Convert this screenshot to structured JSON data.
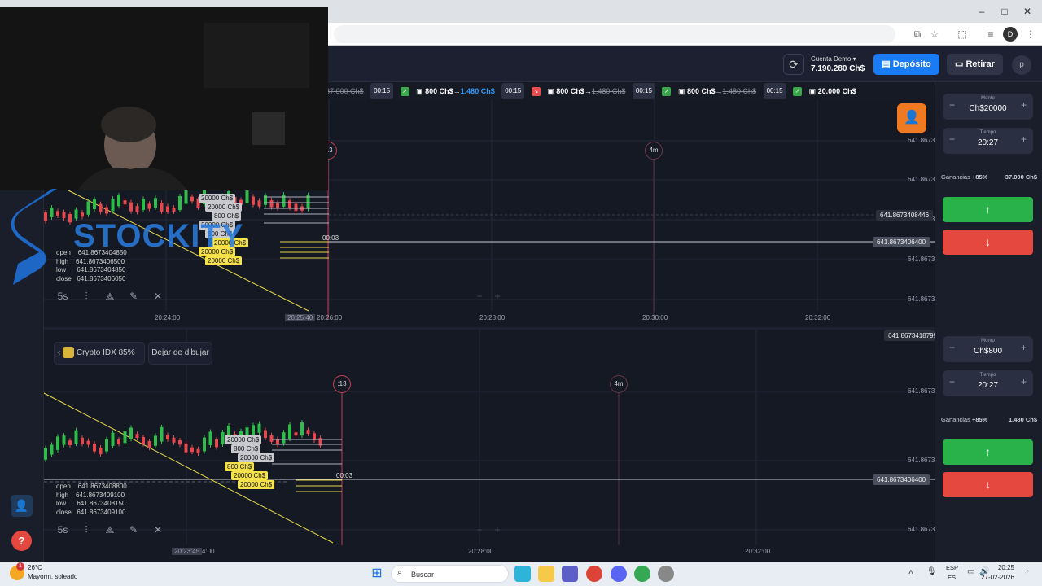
{
  "browser": {
    "window_controls": {
      "minimize": "–",
      "maximize": "□",
      "close": "✕"
    },
    "profile_initial": "D"
  },
  "header": {
    "account_label": "Cuenta Demo",
    "account_balance": "7.190.280 Ch$",
    "deposit_label": "Depósito",
    "withdraw_label": "Retirar",
    "avatar_initial": "p"
  },
  "ticker": [
    {
      "amount": "37.000 Ch$",
      "struck": true,
      "time": "00:15",
      "dir": "up"
    },
    {
      "amount_from": "800 Ch$",
      "amount_to": "1.480 Ch$",
      "time": "00:15",
      "dir": "down"
    },
    {
      "amount_from": "800 Ch$",
      "amount_to": "1.480 Ch$",
      "time": "00:15",
      "dir": "up"
    },
    {
      "amount_from": "800 Ch$",
      "amount_to": "1.480 Ch$",
      "time": "00:15",
      "dir": "up"
    },
    {
      "amount_from": "20.000 Ch$",
      "time": ""
    }
  ],
  "chart1": {
    "ohlc": {
      "open": "641.8673404850",
      "high": "641.8673406500",
      "low": "641.8673404850",
      "close": "641.8673406050"
    },
    "y_ticks": [
      "641.8673",
      "641.8673",
      "641.8673",
      "641.8673",
      "641.8673"
    ],
    "price_tags": [
      "641.8673408446",
      "641.8673406400"
    ],
    "x_ticks": [
      "20:24:00",
      "20:26:00",
      "20:28:00",
      "20:30:00",
      "20:32:00"
    ],
    "x_highlight": "20:25:40",
    "timer_a": ":13",
    "timer_b": "4m",
    "countdown": "00:03",
    "timeframe": "5s",
    "trade_labels": [
      "20000 Ch$",
      "20000 Ch$",
      "800 Ch$",
      "20000 Ch$",
      "800 Ch$",
      "20000 Ch$",
      "20000 Ch$",
      "20000 Ch$"
    ]
  },
  "chart2": {
    "asset": "Crypto IDX 85%",
    "stop_drawing": "Dejar de dibujar",
    "ohlc": {
      "open": "641.8673408800",
      "high": "641.8673409100",
      "low": "641.8673408150",
      "close": "641.8673409100"
    },
    "y_ticks": [
      "641.8673",
      "641.8673",
      "641.8673",
      "641.8673"
    ],
    "price_tags": [
      "641.8673418799",
      "641.8673406400"
    ],
    "x_ticks": [
      "20:23:45",
      "20:28:00",
      "20:32:00"
    ],
    "x_tick_partial": "4:00",
    "timer_a": ":13",
    "timer_b": "4m",
    "countdown": "00:03",
    "timeframe": "5s",
    "trade_labels": [
      "20000 Ch$",
      "800 Ch$",
      "20000 Ch$",
      "800 Ch$",
      "20000 Ch$",
      "20000 Ch$"
    ]
  },
  "ohlc_labels": {
    "open": "open",
    "high": "high",
    "low": "low",
    "close": "close"
  },
  "panel1": {
    "amount_label": "Monto",
    "amount": "Ch$20000",
    "time_label": "Tiempo",
    "time": "20:27",
    "profit_label": "Ganancias",
    "profit_pct": "+85%",
    "profit_value": "37.000 Ch$"
  },
  "panel2": {
    "amount_label": "Monto",
    "amount": "Ch$800",
    "time_label": "Tiempo",
    "time": "20:27",
    "profit_label": "Ganancias",
    "profit_pct": "+85%",
    "profit_value": "1.480 Ch$"
  },
  "watermark": "STOCKITY",
  "taskbar": {
    "weather_temp": "26°C",
    "weather_desc": "Mayorm. soleado",
    "weather_badge": "1",
    "search_placeholder": "Buscar",
    "lang_top": "ESP",
    "lang_bottom": "ES",
    "time": "20:25",
    "date": "27-02-2026"
  },
  "colors": {
    "accent_blue": "#1a7cf4",
    "up_green": "#29b14a",
    "down_red": "#e5483f",
    "orange_fab": "#f07a21",
    "bg": "#151924"
  }
}
